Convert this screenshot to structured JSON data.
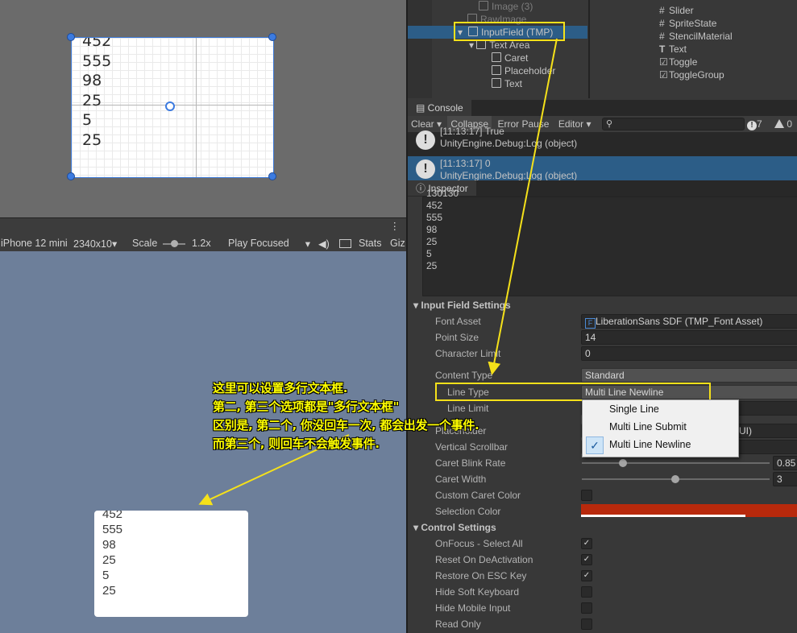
{
  "scene": {
    "lines": [
      "452",
      "555",
      "98",
      "25",
      "5",
      "25"
    ]
  },
  "game_toolbar": {
    "device": "iPhone 12 mini",
    "resolution": "2340x10▾",
    "scale_label": "Scale",
    "scale_value": "1.2x",
    "play_mode": "Play Focused",
    "stats": "Stats",
    "gizmos": "Giz",
    "menu_dots": "⋮"
  },
  "game": {
    "lines": [
      "452",
      "555",
      "98",
      "25",
      "5",
      "25"
    ]
  },
  "hierarchy": {
    "items": [
      {
        "label": "Image (3)",
        "dim": true
      },
      {
        "label": "RawImage",
        "dim": true
      },
      {
        "label": "InputField (TMP)",
        "dim": false
      },
      {
        "label": "Text Area",
        "dim": false
      },
      {
        "label": "Caret",
        "dim": false
      },
      {
        "label": "Placeholder",
        "dim": false
      },
      {
        "label": "Text",
        "dim": false
      }
    ]
  },
  "project": {
    "items": [
      "Slider",
      "SpriteState",
      "StencilMaterial",
      "Text",
      "Toggle",
      "ToggleGroup"
    ]
  },
  "console": {
    "tab": "Console",
    "clear": "Clear",
    "clear_arrow": "▾",
    "collapse": "Collapse",
    "error_pause": "Error Pause",
    "editor": "Editor ▾",
    "info_count": "7",
    "warn_count": "0",
    "logs": [
      {
        "time": "[11:13:17] True",
        "source": "UnityEngine.Debug:Log (object)"
      },
      {
        "time": "[11:13:17] 0",
        "source": "UnityEngine.Debug:Log (object)"
      }
    ]
  },
  "inspector": {
    "tab": "Inspector",
    "text_lines": [
      "130130",
      "452",
      "555",
      "98",
      "25",
      "5",
      "25"
    ],
    "input_field_settings": "Input Field Settings",
    "font_asset_label": "Font Asset",
    "font_asset_value": "LiberationSans SDF (TMP_Font Asset)",
    "point_size_label": "Point Size",
    "point_size_value": "14",
    "character_limit_label": "Character Limit",
    "character_limit_value": "0",
    "content_type_label": "Content Type",
    "content_type_value": "Standard",
    "line_type_label": "Line Type",
    "line_type_value": "Multi Line Newline",
    "line_limit_label": "Line Limit",
    "placeholder_label": "Placeholder",
    "placeholder_value_tail": "UI)",
    "vertical_scrollbar_label": "Vertical Scrollbar",
    "caret_blink_label": "Caret Blink Rate",
    "caret_blink_value": "0.85",
    "caret_width_label": "Caret Width",
    "caret_width_value": "3",
    "custom_caret_label": "Custom Caret Color",
    "selection_color_label": "Selection Color",
    "control_settings": "Control Settings",
    "onfocus_label": "OnFocus - Select All",
    "reset_label": "Reset On DeActivation",
    "restore_label": "Restore On ESC Key",
    "hide_soft_label": "Hide Soft Keyboard",
    "hide_mobile_label": "Hide Mobile Input",
    "read_only_label": "Read Only"
  },
  "popup": {
    "items": [
      "Single Line",
      "Multi Line Submit",
      "Multi Line Newline"
    ],
    "checked_index": 2
  },
  "annotation": {
    "lines": [
      "这里可以设置多行文本框.",
      "第二, 第三个选项都是\"多行文本框\"",
      "区别是, 第二个, 你没回车一次, 都会出发一个事件.",
      "而第三个, 则回车不会触发事件."
    ]
  },
  "colors": {
    "annotation": "#ffff00",
    "selection_color": "#b8290c",
    "selected_row": "#2c5d87"
  }
}
